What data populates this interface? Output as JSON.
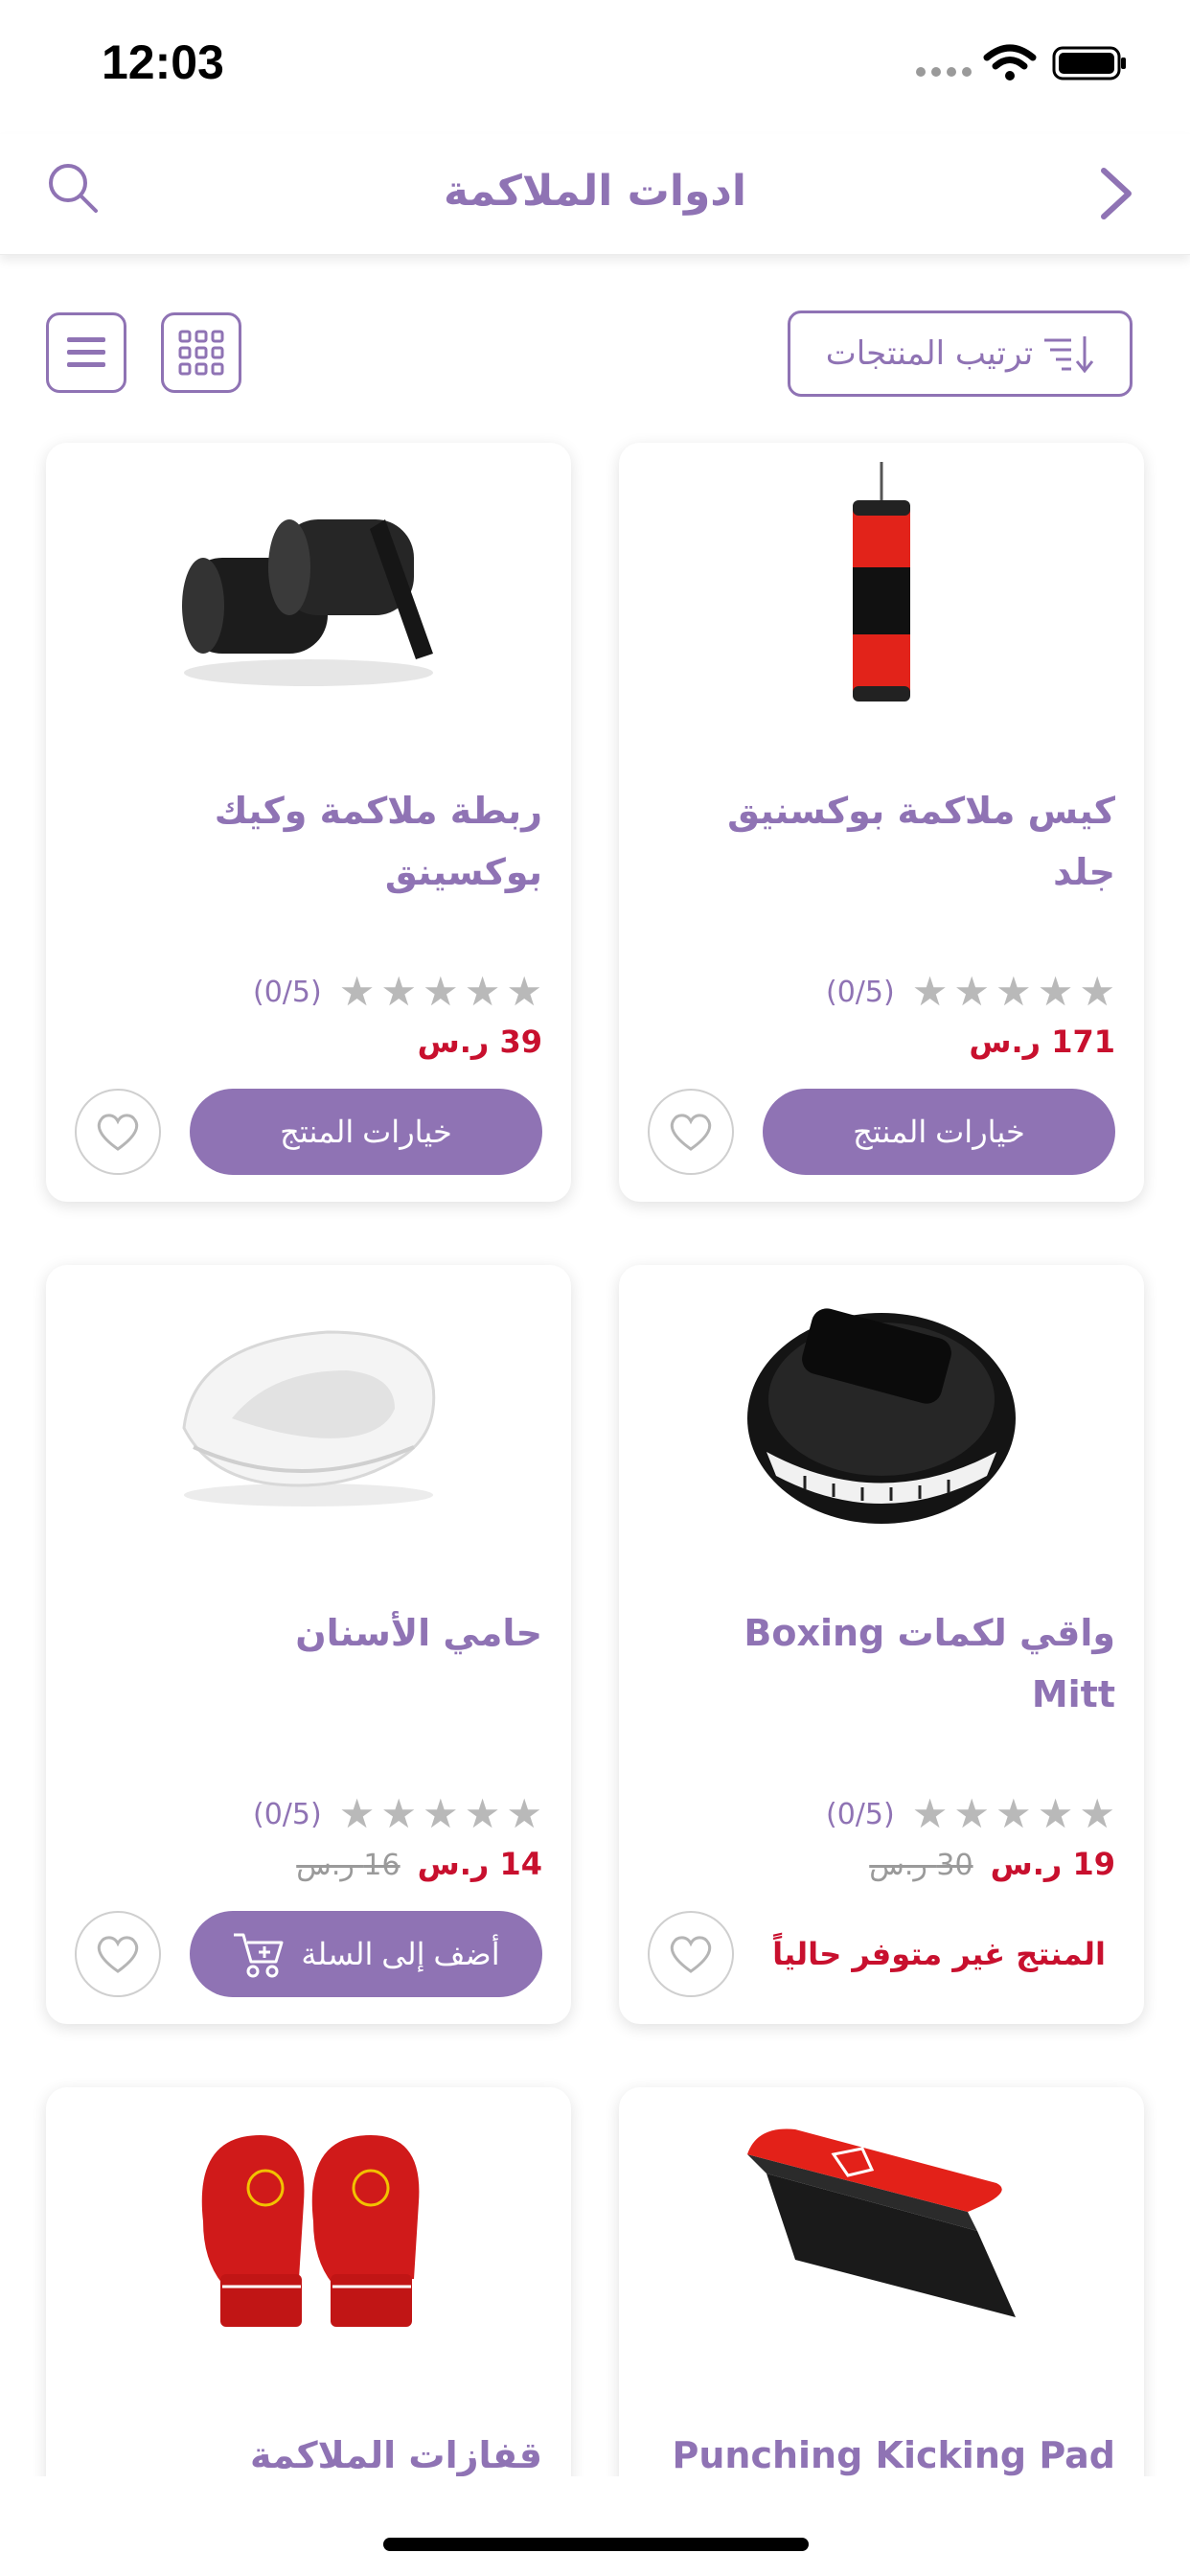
{
  "status_bar": {
    "time": "12:03"
  },
  "header": {
    "title": "ادوات الملاكمة",
    "search_icon": "search-icon",
    "back_icon": "chevron-right-icon"
  },
  "toolbar": {
    "sort_label": "ترتيب المنتجات",
    "view_list_icon": "list-view-icon",
    "view_grid_icon": "grid-view-icon"
  },
  "colors": {
    "accent": "#8f73b4",
    "price": "#c8102e",
    "star": "#b9b9b9"
  },
  "products": [
    {
      "name": "كيس ملاكمة بوكسنيق جلد",
      "rating": "(0/5)",
      "price": "171 ر.س",
      "old_price": "",
      "action": "خيارات المنتج",
      "image": "punching-bag-image"
    },
    {
      "name": "ربطة ملاكمة وكيك بوكسينق",
      "rating": "(0/5)",
      "price": "39 ر.س",
      "old_price": "",
      "action": "خيارات المنتج",
      "image": "hand-wraps-image"
    },
    {
      "name": "واقي لكمات Boxing Mitt",
      "rating": "(0/5)",
      "price": "19 ر.س",
      "old_price": "30 ر.س",
      "action": "المنتج غير متوفر حالياً",
      "image": "focus-mitt-image"
    },
    {
      "name": "حامي الأسنان",
      "rating": "(0/5)",
      "price": "14 ر.س",
      "old_price": "16 ر.س",
      "action": "أضف إلى السلة",
      "image": "mouthguard-image"
    },
    {
      "name": "Punching Kicking Pad",
      "image": "kick-pad-image"
    },
    {
      "name": "قفازات الملاكمة",
      "image": "boxing-gloves-image"
    }
  ]
}
